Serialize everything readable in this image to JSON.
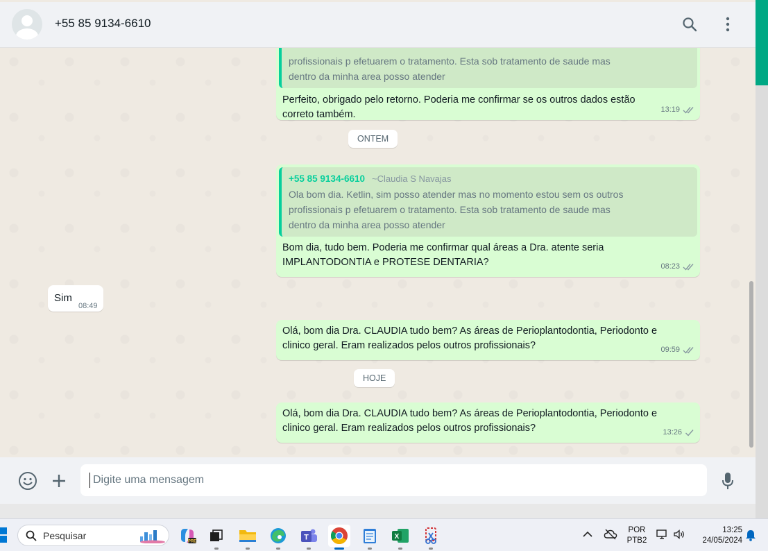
{
  "header": {
    "contact": "+55 85 9134-6610",
    "search_icon": "search-icon",
    "menu_icon": "kebab-menu-icon"
  },
  "colors": {
    "accent": "#00a884",
    "outgoing_bubble": "#d9fdd3",
    "incoming_bubble": "#ffffff",
    "quote_bar": "#06cf9c"
  },
  "messages": [
    {
      "direction": "out",
      "quote_lines": [
        "profissionais p efetuarem o tratamento. Esta sob tratamento de saude mas",
        "dentro da minha area posso atender"
      ],
      "text_lines": [
        "Perfeito, obrigado pelo retorno. Poderia me confirmar se os outros dados estão",
        "correto também."
      ],
      "time": "13:19",
      "status": "read"
    },
    {
      "date_chip": "ONTEM"
    },
    {
      "direction": "out",
      "quote_author": "+55 85 9134-6610",
      "quote_name": "~Claudia S Navajas",
      "quote_lines": [
        "Ola bom dia. Ketlin, sim posso atender mas no momento estou sem os outros",
        "profissionais p efetuarem o tratamento. Esta sob tratamento de saude mas",
        "dentro da minha area posso atender"
      ],
      "text_lines": [
        "Bom dia, tudo bem. Poderia me confirmar qual áreas a Dra. atente seria",
        "IMPLANTODONTIA  e PROTESE DENTARIA?"
      ],
      "time": "08:23",
      "status": "read"
    },
    {
      "direction": "in",
      "text": "Sim",
      "time": "08:49"
    },
    {
      "direction": "out",
      "text_lines": [
        "Olá, bom dia Dra. CLAUDIA tudo bem? As áreas de Perioplantodontia, Periodonto e",
        "clinico geral. Eram realizados pelos outros profissionais?"
      ],
      "time": "09:59",
      "status": "read"
    },
    {
      "date_chip": "HOJE"
    },
    {
      "direction": "out",
      "text_lines": [
        "Olá, bom dia Dra. CLAUDIA tudo bem? As áreas de Perioplantodontia, Periodonto e",
        "clinico geral. Eram realizados pelos outros profissionais?"
      ],
      "time": "13:26",
      "status": "sent"
    }
  ],
  "composer": {
    "placeholder": "Digite uma mensagem",
    "emoji_icon": "emoji-icon",
    "attach_icon": "plus-icon",
    "mic_icon": "microphone-icon"
  },
  "taskbar": {
    "search_label": "Pesquisar",
    "apps": [
      "copilot-icon",
      "task-view-icon",
      "file-explorer-icon",
      "edge-icon",
      "teams-icon",
      "chrome-icon",
      "notepad-icon",
      "excel-icon",
      "snipping-tool-icon"
    ],
    "lang_line1": "POR",
    "lang_line2": "PTB2",
    "clock_time": "13:25",
    "clock_date": "24/05/2024"
  }
}
